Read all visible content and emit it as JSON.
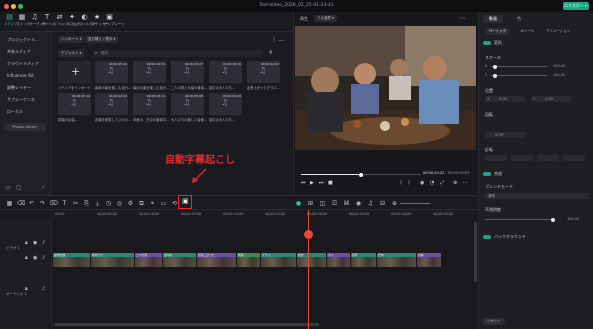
{
  "window": {
    "title": "Test-Video_2026_02_25-01-23-41",
    "export_label": "エクスポート"
  },
  "toolbar": {
    "tools": [
      {
        "label": "メディア",
        "icon": "media-icon",
        "active": true
      },
      {
        "label": "ストック",
        "icon": "stock-icon"
      },
      {
        "label": "オーディオ",
        "icon": "audio-icon"
      },
      {
        "label": "タイトル",
        "icon": "title-icon"
      },
      {
        "label": "トランジション",
        "icon": "transition-icon"
      },
      {
        "label": "エフェクト",
        "icon": "effects-icon"
      },
      {
        "label": "フィルター",
        "icon": "filter-icon"
      },
      {
        "label": "ステッカー",
        "icon": "sticker-icon"
      },
      {
        "label": "テンプレート",
        "icon": "template-icon"
      }
    ]
  },
  "sidebar": {
    "items": [
      {
        "label": "プロジェクトメ...",
        "active": true
      },
      {
        "label": "共有メディア"
      },
      {
        "label": "クラウドメディア"
      },
      {
        "label": "Influencer Kit"
      },
      {
        "label": "調整レイヤー"
      },
      {
        "label": "サブシーケンス"
      },
      {
        "label": "ローカル"
      }
    ],
    "photos_library": "Photos Library"
  },
  "media": {
    "import_label": "インポート",
    "filter_label": "並び替え / 表示",
    "default_label": "デフォルト",
    "search_placeholder": "検索",
    "import_tile_caption": "メディアをインポート",
    "clips": [
      {
        "duration": "00:00:05:02",
        "caption": "最後の曲を楽しむ自分..."
      },
      {
        "duration": "00:00:04:15",
        "caption": "最初の曲を楽しむ自分..."
      },
      {
        "duration": "00:00:03:27",
        "caption": "二人の男と大量の食事..."
      },
      {
        "duration": "00:00:06:10",
        "caption": "話中の大人たち..."
      },
      {
        "duration": "00:00:04:02",
        "caption": "出来上がったグラス..."
      },
      {
        "duration": "00:00:05:14",
        "caption": "笑顔の友達..."
      },
      {
        "duration": "00:00:04:20",
        "caption": "石脇を読書していたの..."
      },
      {
        "duration": "00:00:03:11",
        "caption": "本音の、日中の食事中..."
      },
      {
        "duration": "00:00:05:08",
        "caption": "大人たちの楽しい会食..."
      },
      {
        "duration": "00:00:04:28",
        "caption": "話中の大人たち..."
      }
    ]
  },
  "annotation": {
    "text": "自動字幕起こし"
  },
  "player": {
    "quality_label": "再生",
    "fit_label": "フル品質",
    "current_time": "00:00:20:22",
    "total_time": "00:00:54:03"
  },
  "inspector": {
    "tabs": [
      "動画",
      "色"
    ],
    "subtabs": [
      "ベーシック",
      "AIツール",
      "アニメーション"
    ],
    "sections": {
      "transform": "変形",
      "scale": "スケール",
      "scale_x": "100.00",
      "scale_y": "100.00",
      "position": "位置",
      "pos_x": "0.00",
      "pos_y": "0.00",
      "rotation": "回転",
      "rotation_val": "0.00°",
      "flip": "反転",
      "compositing": "合成",
      "blend_mode": "ブレンドモード",
      "blend_value": "通常",
      "opacity": "不透明度",
      "opacity_val": "100.00",
      "background": "バックグラウンド",
      "reset": "リセット"
    }
  },
  "timeline": {
    "ticks": [
      "00:00",
      "00:00:05:00",
      "00:00:10:00",
      "00:00:15:00",
      "00:00:20:00",
      "00:00:25:00",
      "00:00:30:00",
      "00:00:35:00",
      "00:00:40:00",
      "00:00:45:00"
    ],
    "track_labels": [
      "ビデオ 1",
      "オーディオ 1"
    ],
    "clips": [
      {
        "label": "最後の曲",
        "kind": "v"
      },
      {
        "label": "初めての",
        "kind": "v"
      },
      {
        "label": "二人の男",
        "kind": "a"
      },
      {
        "label": "話中の",
        "kind": "v"
      },
      {
        "label": "出来上がった",
        "kind": "a"
      },
      {
        "label": "笑顔",
        "kind": "g"
      },
      {
        "label": "グラス",
        "kind": "v"
      },
      {
        "label": "会食",
        "kind": "v"
      },
      {
        "label": "大人",
        "kind": "a"
      },
      {
        "label": "乾杯",
        "kind": "v"
      },
      {
        "label": "日中",
        "kind": "v"
      },
      {
        "label": "食事",
        "kind": "a"
      }
    ]
  },
  "colors": {
    "accent": "#1aa58a",
    "annotation": "#e8262e",
    "playhead": "#e8483a"
  }
}
